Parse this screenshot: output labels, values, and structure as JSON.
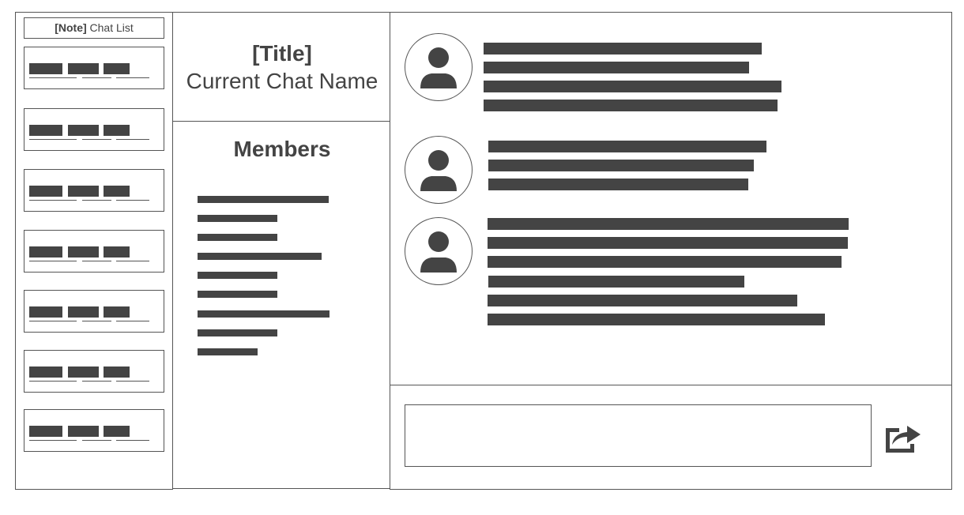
{
  "sidebar": {
    "note_tag": "[Note]",
    "note_text": "Chat List",
    "chat_items_count": 7
  },
  "title_panel": {
    "title_label": "[Title]",
    "chat_name": "Current Chat Name"
  },
  "members_panel": {
    "heading": "Members"
  },
  "composer": {
    "input_value": ""
  },
  "icons": {
    "avatar": "user-avatar-icon",
    "send": "share-send-icon"
  },
  "colors": {
    "ink": "#444444",
    "border": "#555555",
    "background": "#ffffff"
  }
}
